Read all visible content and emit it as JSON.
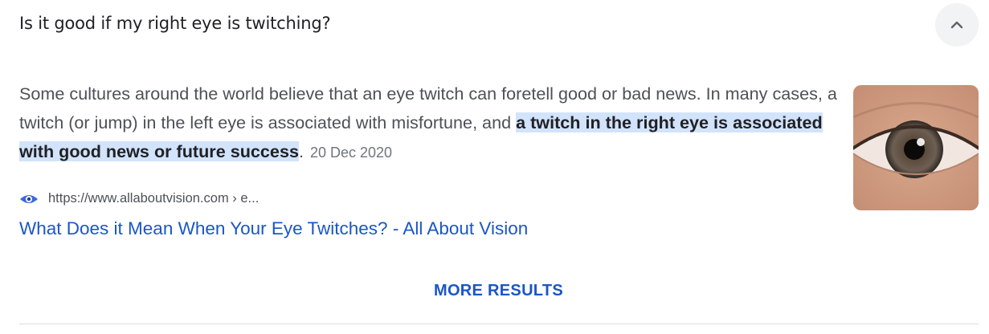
{
  "question": "Is it good if my right eye is twitching?",
  "snippet": {
    "text_before": "Some cultures around the world believe that an eye twitch can foretell good or bad news. In many cases, a twitch (or jump) in the left eye is associated with misfortune, and ",
    "highlight": "a twitch in the right eye is associated with good news or future success",
    "text_after": ".",
    "date": "20 Dec 2020"
  },
  "source": {
    "favicon": "eye-favicon-icon",
    "url": "https://www.allaboutvision.com › e..."
  },
  "result_title": "What Does it Mean When Your Eye Twitches? - All About Vision",
  "more_results_label": "MORE RESULTS",
  "icons": {
    "collapse": "chevron-up-icon"
  },
  "colors": {
    "link": "#1a56c8",
    "highlight": "#d2e3fc"
  }
}
